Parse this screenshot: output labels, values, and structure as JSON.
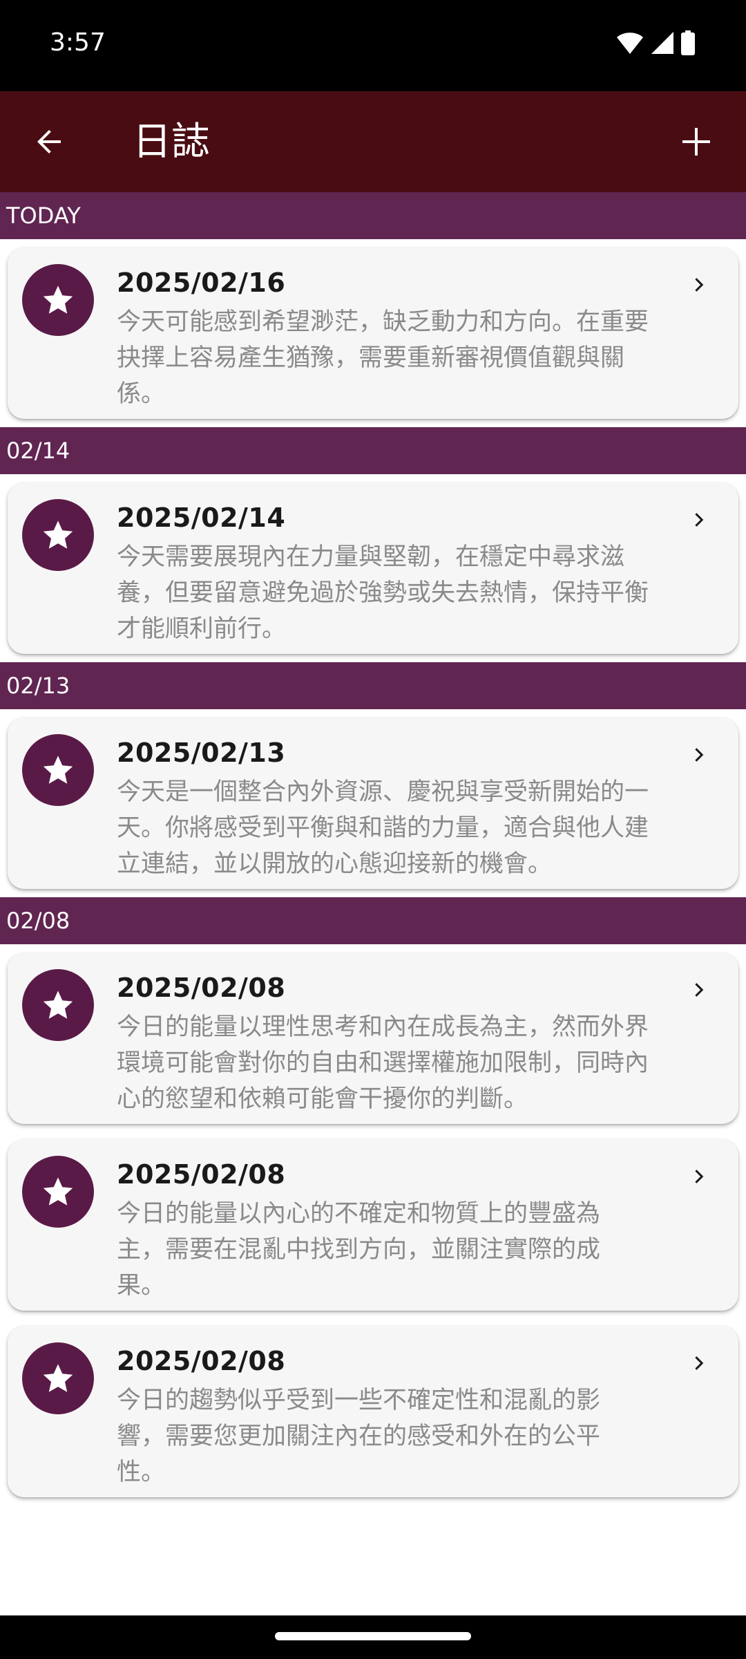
{
  "status_bar": {
    "time": "3:57",
    "icons": [
      "wifi-icon",
      "signal-icon",
      "battery-icon"
    ]
  },
  "app_bar": {
    "title": "日誌",
    "back_icon": "arrow-left-icon",
    "add_icon": "plus-icon"
  },
  "colors": {
    "app_bar": "#4a0c13",
    "section_header": "#612552",
    "avatar": "#5a1a47",
    "card_bg": "#f6f6f6"
  },
  "sections": [
    {
      "header": "TODAY",
      "entries": [
        {
          "date": "2025/02/16",
          "text": "今天可能感到希望渺茫，缺乏動力和方向。在重要抉擇上容易產生猶豫，需要重新審視價值觀與關係。"
        }
      ]
    },
    {
      "header": "02/14",
      "entries": [
        {
          "date": "2025/02/14",
          "text": "今天需要展現內在力量與堅韌，在穩定中尋求滋養，但要留意避免過於強勢或失去熱情，保持平衡才能順利前行。"
        }
      ]
    },
    {
      "header": "02/13",
      "entries": [
        {
          "date": "2025/02/13",
          "text": "今天是一個整合內外資源、慶祝與享受新開始的一天。你將感受到平衡與和諧的力量，適合與他人建立連結，並以開放的心態迎接新的機會。"
        }
      ]
    },
    {
      "header": "02/08",
      "entries": [
        {
          "date": "2025/02/08",
          "text": "今日的能量以理性思考和內在成長為主，然而外界環境可能會對你的自由和選擇權施加限制，同時內心的慾望和依賴可能會干擾你的判斷。"
        },
        {
          "date": "2025/02/08",
          "text": "今日的能量以內心的不確定和物質上的豐盛為主，需要在混亂中找到方向，並關注實際的成果。"
        },
        {
          "date": "2025/02/08",
          "text": "今日的趨勢似乎受到一些不確定性和混亂的影響，需要您更加關注內在的感受和外在的公平性。"
        }
      ]
    }
  ]
}
